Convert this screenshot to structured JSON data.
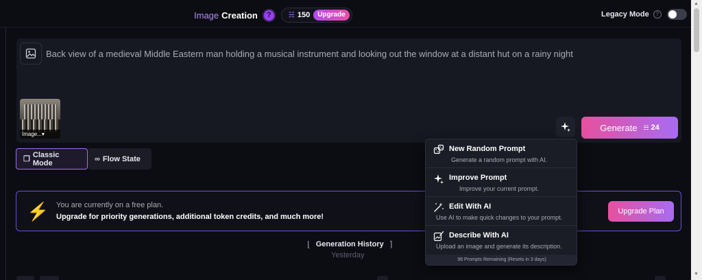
{
  "header": {
    "title_part1": "Image",
    "title_part2": "Creation",
    "help_icon": "?",
    "credits": "150",
    "upgrade_label": "Upgrade",
    "legacy_mode_label": "Legacy Mode",
    "legacy_help": "?",
    "legacy_mode_on": false
  },
  "prompt": {
    "text": "Back view of a medieval Middle Eastern man holding a musical instrument and looking out the window at a distant hut on a rainy night",
    "thumbnail_label": "Image...▾",
    "generate_label": "Generate",
    "generate_cost": "24"
  },
  "modes": [
    {
      "label": "Classic Mode",
      "active": true
    },
    {
      "label": "Flow State",
      "active": false
    }
  ],
  "plan": {
    "line1": "You are currently on a free plan.",
    "line2": "Upgrade for priority generations, additional token credits, and much more!",
    "button": "Upgrade Plan"
  },
  "history": {
    "label": "Generation History",
    "date_group": "Yesterday"
  },
  "dropdown": {
    "items": [
      {
        "icon": "random-prompt-icon",
        "title": "New Random Prompt",
        "desc": "Generate a random prompt with AI."
      },
      {
        "icon": "sparkle-icon",
        "title": "Improve Prompt",
        "desc": "Improve your current prompt."
      },
      {
        "icon": "magic-wand-icon",
        "title": "Edit With AI",
        "desc": "Use AI to make quick changes to your prompt."
      },
      {
        "icon": "describe-image-icon",
        "title": "Describe With AI",
        "desc": "Upload an image and generate its description."
      }
    ],
    "footer": "98 Prompts Remaining (Resets in 3 days)"
  },
  "colors": {
    "accent_purple": "#a46ef5",
    "accent_pink": "#e7509e",
    "background": "#0c0d12",
    "card": "#161822"
  }
}
